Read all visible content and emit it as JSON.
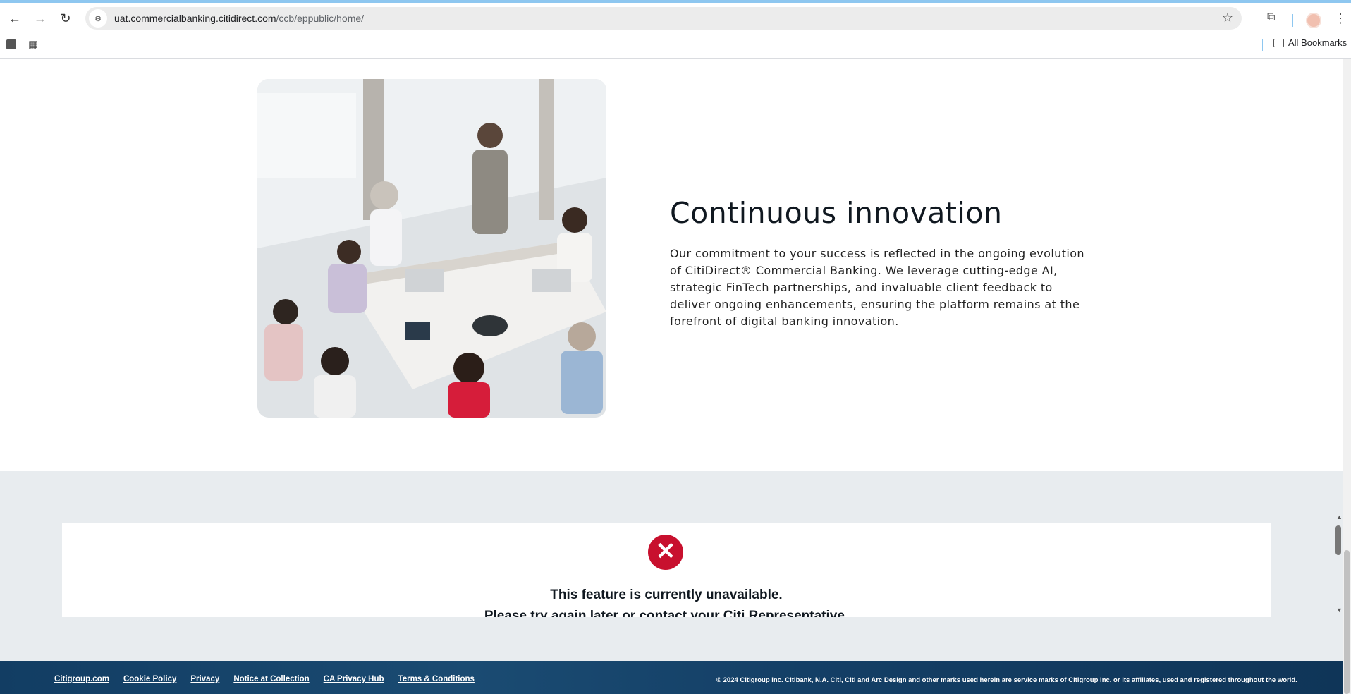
{
  "browser": {
    "url_domain": "uat.commercialbanking.citidirect.com",
    "url_path": "/ccb/eppublic/home/",
    "bookmarks_label": "All Bookmarks"
  },
  "hero": {
    "title": "Continuous innovation",
    "body": "Our commitment to your success is reflected in the ongoing evolution of CitiDirect® Commercial Banking. We leverage cutting-edge AI, strategic FinTech partnerships, and invaluable client feedback to deliver ongoing enhancements, ensuring the platform remains at the forefront of digital banking innovation."
  },
  "error": {
    "title": "This feature is currently unavailable.",
    "subtitle": "Please try again later or contact your Citi Representative."
  },
  "footer": {
    "links": [
      "Citigroup.com",
      "Cookie Policy",
      "Privacy",
      "Notice at Collection",
      "CA Privacy Hub",
      "Terms & Conditions"
    ],
    "copyright": "© 2024 Citigroup Inc. Citibank, N.A. Citi, Citi and Arc Design and other marks used herein are service marks of Citigroup Inc. or its affiliates, used and registered throughout the world."
  },
  "colors": {
    "error_red": "#c8102e",
    "footer_blue": "#123d63",
    "band_gray": "#e8ecef"
  }
}
